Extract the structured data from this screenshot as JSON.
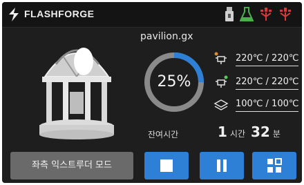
{
  "header": {
    "brand": "FLASHFORGE",
    "icons": [
      "flashforge-logo-icon",
      "usb-icon",
      "lab-flask-icon",
      "wifi-signal-icon",
      "wifi-signal-icon"
    ]
  },
  "job": {
    "filename": "pavilion.gx",
    "progress_text": "25%",
    "progress": 0.25
  },
  "temps": [
    {
      "icon": "extruder-left-icon",
      "value": "220℃ / 220℃"
    },
    {
      "icon": "extruder-right-icon",
      "value": "220℃ / 220℃"
    },
    {
      "icon": "heated-bed-icon",
      "value": "100℃ / 100℃"
    }
  ],
  "remaining": {
    "label": "잔여시간",
    "hours": "1",
    "hours_unit": "시간",
    "minutes": "32",
    "minutes_unit": "분"
  },
  "buttons": {
    "mode_label": "좌측 익스트루더 모드",
    "stop_icon": "stop-icon",
    "pause_icon": "pause-icon",
    "menu_icon": "menu-grid-icon"
  },
  "colors": {
    "background": "#1e1e1e",
    "accent": "#2e7fd6",
    "progress_track": "#8a8a8a",
    "progress_fill": "#2e7fd6",
    "mode_button": "#6a6a6a"
  }
}
